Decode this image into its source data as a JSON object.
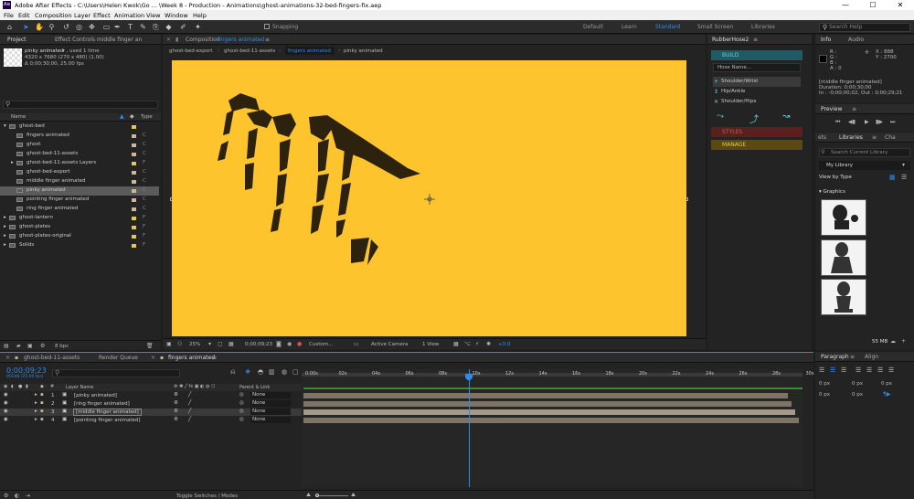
{
  "window": {
    "title": "Adobe After Effects - C:\\Users\\Helen Kwok\\Go ... \\Week 8 - Production - Animations\\ghost-animations-32-bed-fingers-fix.aep",
    "app_icon": "Ae",
    "minimize": "—",
    "maximize": "☐",
    "close": "✕"
  },
  "menu": [
    "File",
    "Edit",
    "Composition",
    "Layer",
    "Effect",
    "Animation",
    "View",
    "Window",
    "Help"
  ],
  "toolbar": {
    "snapping": "Snapping",
    "workspaces": [
      "Default",
      "Learn",
      "Standard",
      "Small Screen",
      "Libraries"
    ],
    "active_workspace": "Standard",
    "search_placeholder": "Search Help"
  },
  "project": {
    "tab_project": "Project",
    "tab_effect": "Effect Controls middle finger an",
    "selected_name": "pinky animated",
    "used": "▾ , used 1 time",
    "dims": "4320 x 7680 (270 x 480) (1.00)",
    "duration": "Δ 0;00;30;00, 25.00 fps",
    "col_name": "Name",
    "col_type": "Type",
    "bpc": "8 bpc",
    "items": [
      {
        "name": "ghost-bed",
        "indent": 0,
        "arrow": "▾",
        "color": "#e7c94a",
        "type": ""
      },
      {
        "name": "fingers animated",
        "indent": 1,
        "arrow": "",
        "color": "#cbb79a",
        "type": "C"
      },
      {
        "name": "ghost",
        "indent": 1,
        "arrow": "",
        "color": "#cbb79a",
        "type": "C"
      },
      {
        "name": "ghost-bed-11-assets",
        "indent": 1,
        "arrow": "",
        "color": "#cbb79a",
        "type": "C"
      },
      {
        "name": "ghost-bed-11-assets Layers",
        "indent": 1,
        "arrow": "▸",
        "color": "#e7c94a",
        "type": "F"
      },
      {
        "name": "ghost-bed-export",
        "indent": 1,
        "arrow": "",
        "color": "#cbb79a",
        "type": "C"
      },
      {
        "name": "middle finger animated",
        "indent": 1,
        "arrow": "",
        "color": "#cbb79a",
        "type": "C"
      },
      {
        "name": "pinky animated",
        "indent": 1,
        "arrow": "",
        "color": "#cbb79a",
        "type": "C",
        "selected": true
      },
      {
        "name": "pointing finger animated",
        "indent": 1,
        "arrow": "",
        "color": "#cbb79a",
        "type": "C"
      },
      {
        "name": "ring finger animated",
        "indent": 1,
        "arrow": "",
        "color": "#cbb79a",
        "type": "C"
      },
      {
        "name": "ghost-lantern",
        "indent": 0,
        "arrow": "▸",
        "color": "#e7c94a",
        "type": "F"
      },
      {
        "name": "ghost-plates",
        "indent": 0,
        "arrow": "▸",
        "color": "#e7c94a",
        "type": "F"
      },
      {
        "name": "ghost-plates-original",
        "indent": 0,
        "arrow": "▸",
        "color": "#e7c94a",
        "type": "F"
      },
      {
        "name": "Solids",
        "indent": 0,
        "arrow": "▸",
        "color": "#e7c94a",
        "type": "F"
      }
    ]
  },
  "composition": {
    "tab_label": "Composition",
    "tab_name": "fingers animated",
    "breadcrumbs": [
      "ghost-bed-export",
      "ghost-bed-11-assets",
      "fingers animated",
      "pinky animated"
    ],
    "zoom": "25%",
    "timecode": "0;00;09;23",
    "view": "Custom...",
    "camera": "Active Camera",
    "views": "1 View",
    "exposure": "+0.0"
  },
  "rubberhose": {
    "tab": "RubberHose2",
    "build": "BUILD",
    "hose_name": "Hose Name...",
    "options": [
      "Shoulder/Wrist",
      "Hip/Ankle",
      "Shoulder/Hips"
    ],
    "styles": "STYLES",
    "manage": "MANAGE"
  },
  "info": {
    "tab_info": "Info",
    "tab_audio": "Audio",
    "r": "R :",
    "g": "G :",
    "b": "B :",
    "a": "A : 0",
    "x": "X : 888",
    "y": "Y : 2700",
    "layer": "[middle finger animated]",
    "dur": "Duration: 0;00;30;00",
    "inout": "In : -0;00;00;02, Out : 0;00;29;21"
  },
  "preview": {
    "tab": "Preview"
  },
  "libraries": {
    "tabs": [
      "ets",
      "Libraries",
      "Cha"
    ],
    "search": "Search Current Library",
    "library": "My Library",
    "view_by": "View by Type",
    "graphics": "Graphics",
    "size": "55 MB"
  },
  "paragraph": {
    "tab": "Paragraph",
    "tab_align": "Align",
    "zeros": "0 px"
  },
  "timeline": {
    "tabs": [
      "ghost-bed-11-assets",
      "Render Queue",
      "fingers animated"
    ],
    "timecode": "0;00;09;23",
    "frame": "00248 (25.00 fps)",
    "col_layer": "Layer Name",
    "col_parent": "Parent & Link",
    "toggle": "Toggle Switches / Modes",
    "ruler": [
      "0:00s",
      "02s",
      "04s",
      "06s",
      "08s",
      "10s",
      "12s",
      "14s",
      "16s",
      "18s",
      "20s",
      "22s",
      "24s",
      "26s",
      "28s",
      "30s"
    ],
    "layers": [
      {
        "num": "1",
        "name": "[pinky animated]",
        "parent": "None"
      },
      {
        "num": "2",
        "name": "[ring finger animated]",
        "parent": "None"
      },
      {
        "num": "3",
        "name": "[middle finger animated]",
        "parent": "None",
        "selected": true
      },
      {
        "num": "4",
        "name": "[pointing finger animated]",
        "parent": "None"
      }
    ]
  },
  "colors": {
    "comp_bg": "#fec42d",
    "accent": "#2d8ceb",
    "label_yellow": "#e7c94a",
    "label_tan": "#cbb79a",
    "build": "#1e5b63",
    "styles": "#5c1f1f",
    "manage": "#5a4a12"
  }
}
